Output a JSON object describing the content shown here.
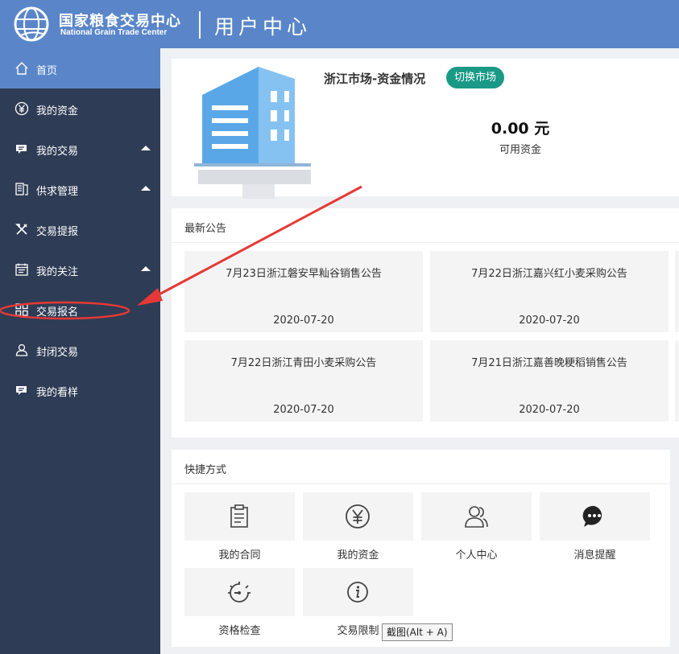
{
  "header": {
    "brand_cn": "国家粮食交易中心",
    "brand_en": "National Grain Trade Center",
    "section_title": "用户中心"
  },
  "sidebar": {
    "items": [
      {
        "label": "首页",
        "icon": "home-icon",
        "active": true,
        "expandable": false
      },
      {
        "label": "我的资金",
        "icon": "yen-circle-icon",
        "active": false,
        "expandable": false
      },
      {
        "label": "我的交易",
        "icon": "chat-icon",
        "active": false,
        "expandable": true
      },
      {
        "label": "供求管理",
        "icon": "document-icon",
        "active": false,
        "expandable": true
      },
      {
        "label": "交易提报",
        "icon": "tools-icon",
        "active": false,
        "expandable": false
      },
      {
        "label": "我的关注",
        "icon": "calendar-icon",
        "active": false,
        "expandable": true
      },
      {
        "label": "交易报名",
        "icon": "grid-icon",
        "active": false,
        "expandable": false
      },
      {
        "label": "封闭交易",
        "icon": "user-icon",
        "active": false,
        "expandable": false
      },
      {
        "label": "我的看样",
        "icon": "chat-icon",
        "active": false,
        "expandable": false
      }
    ]
  },
  "market": {
    "title": "浙江市场-资金情况",
    "switch_label": "切换市场",
    "amount": "0.00 元",
    "amount_label": "可用资金"
  },
  "notices": {
    "title": "最新公告",
    "items": [
      {
        "title": "7月23日浙江磐安早籼谷销售公告",
        "date": "2020-07-20"
      },
      {
        "title": "7月22日浙江嘉兴红小麦采购公告",
        "date": "2020-07-20"
      },
      {
        "title": "7月22日浙江青田小麦采购公告",
        "date": "2020-07-20"
      },
      {
        "title": "7月21日浙江嘉善晚粳稻销售公告",
        "date": "2020-07-20"
      }
    ]
  },
  "shortcuts": {
    "title": "快捷方式",
    "items": [
      {
        "label": "我的合同",
        "icon": "contract-icon"
      },
      {
        "label": "我的资金",
        "icon": "yen-circle-icon"
      },
      {
        "label": "个人中心",
        "icon": "users-icon"
      },
      {
        "label": "消息提醒",
        "icon": "message-bubble-icon"
      },
      {
        "label": "资格检查",
        "icon": "gauge-icon"
      },
      {
        "label": "交易限制",
        "icon": "info-circle-icon"
      }
    ]
  },
  "tooltip": {
    "text": "截图(Alt + A)"
  },
  "colors": {
    "header": "#5a86c9",
    "sidebar": "#2f3c55",
    "active_item": "#5a86c9",
    "switch_button": "#1a9a86",
    "annotation": "#e53935"
  }
}
